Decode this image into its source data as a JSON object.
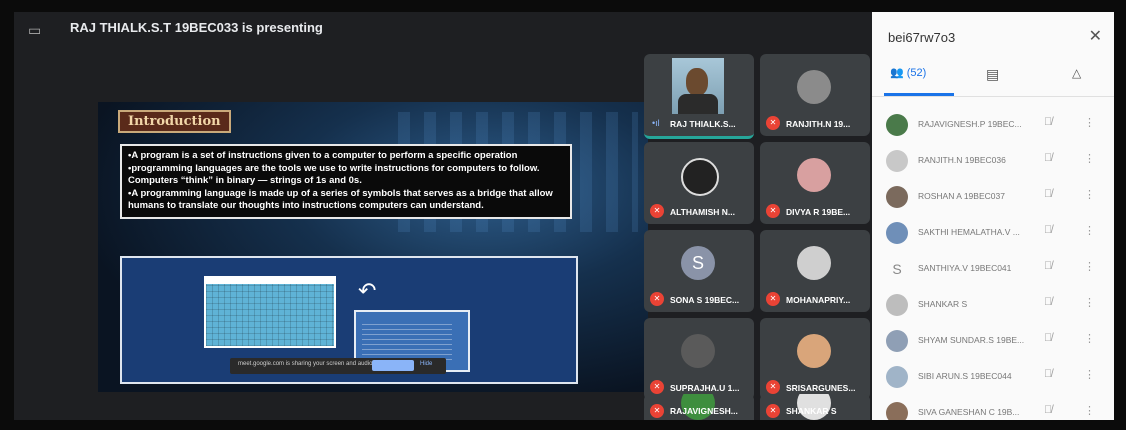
{
  "topbar": {
    "presenting": "RAJ THIALK.S.T 19BEC033 is presenting"
  },
  "slide": {
    "heading": "Introduction",
    "lines": [
      "•A program is a set of instructions given to a computer to perform a specific operation",
      "•programming languages are the tools we use to write instructions for computers to follow. Computers “think” in binary — strings of 1s and 0s.",
      "•A programming language is made up of a series of symbols that serves as a bridge that allow humans to translate our thoughts into instructions computers can understand."
    ],
    "share_text": "meet.google.com is sharing your screen and audio.",
    "share_button": "Stop sharing",
    "hide_button": "Hide"
  },
  "tiles": [
    {
      "name": "RAJ THIALK.S...",
      "muted": false
    },
    {
      "name": "RANJITH.N 19...",
      "muted": true
    },
    {
      "name": "ALTHAMISH N...",
      "muted": true
    },
    {
      "name": "DIVYA R 19BE...",
      "muted": true
    },
    {
      "name": "SONA S 19BEC...",
      "muted": true,
      "initial": "S"
    },
    {
      "name": "MOHANAPRIY...",
      "muted": true
    },
    {
      "name": "SUPRAJHA.U 1...",
      "muted": true
    },
    {
      "name": "SRISARGUNES...",
      "muted": true
    },
    {
      "name": "RAJAVIGNESH...",
      "muted": true
    },
    {
      "name": "SHANKAR S",
      "muted": true
    }
  ],
  "panel": {
    "meeting_code": "bei67rw7o3",
    "people_count": "(52)",
    "participants": [
      "RAJAVIGNESH.P 19BEC...",
      "RANJITH.N 19BEC036",
      "ROSHAN A 19BEC037",
      "SAKTHI HEMALATHA.V ...",
      "SANTHIYA.V 19BEC041",
      "SHANKAR S",
      "SHYAM SUNDAR.S 19BE...",
      "SIBI ARUN.S 19BEC044",
      "SIVA GANESHAN C 19B..."
    ]
  },
  "colors": {
    "accent": "#1a73e8",
    "muted": "#ea4335",
    "speaking": "#26a69a"
  }
}
